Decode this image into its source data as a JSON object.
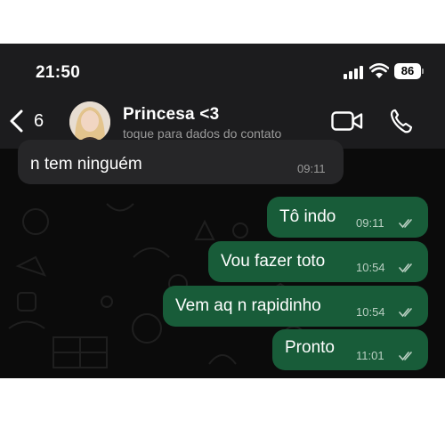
{
  "status_bar": {
    "time": "21:50",
    "battery": "86"
  },
  "header": {
    "back_count": "6",
    "contact_name": "Princesa <3",
    "contact_subtitle": "toque para dados do contato"
  },
  "messages": [
    {
      "direction": "in",
      "text": "n tem ninguém",
      "time": "09:11"
    },
    {
      "direction": "out",
      "text": "Tô indo",
      "time": "09:11",
      "status": "read"
    },
    {
      "direction": "out",
      "text": "Vou fazer toto",
      "time": "10:54",
      "status": "read"
    },
    {
      "direction": "out",
      "text": "Vem aq n rapidinho",
      "time": "10:54",
      "status": "read"
    },
    {
      "direction": "out",
      "text": "Pronto",
      "time": "11:01",
      "status": "read"
    }
  ],
  "colors": {
    "background": "#0b0b0b",
    "header": "#1c1c1e",
    "outgoing_bubble": "#185c39",
    "incoming_bubble": "#262628"
  },
  "icons": [
    "signal-icon",
    "wifi-icon",
    "battery-icon",
    "back-chevron-icon",
    "video-call-icon",
    "phone-icon",
    "read-receipt-icon"
  ]
}
